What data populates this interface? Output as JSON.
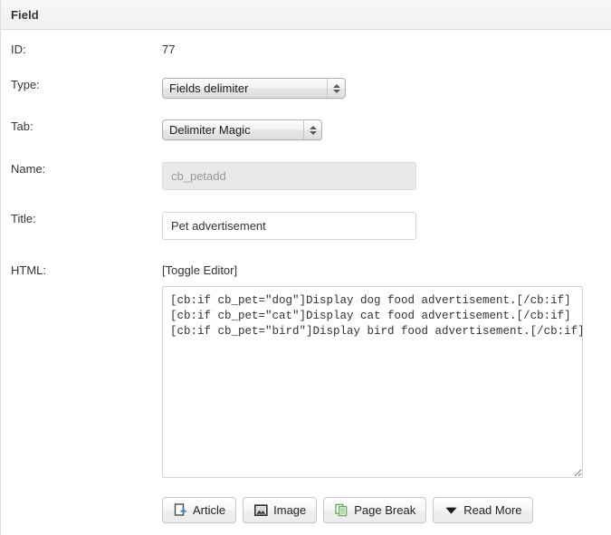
{
  "panel": {
    "header_title": "Field"
  },
  "form": {
    "labels": {
      "id": "ID:",
      "type": "Type:",
      "tab": "Tab:",
      "name": "Name:",
      "title": "Title:",
      "html": "HTML:"
    },
    "id_value": "77",
    "type_select": {
      "selected": "Fields delimiter",
      "options": [
        "Fields delimiter"
      ]
    },
    "tab_select": {
      "selected": "Delimiter Magic",
      "options": [
        "Delimiter Magic"
      ]
    },
    "name_input": {
      "value": "cb_petadd",
      "placeholder": "cb_petadd",
      "disabled": "true"
    },
    "title_input": {
      "value": "Pet advertisement",
      "placeholder": ""
    },
    "html_editor": {
      "toggle_label": "[Toggle Editor]",
      "content": "[cb:if cb_pet=\"dog\"]Display dog food advertisement.[/cb:if]\n[cb:if cb_pet=\"cat\"]Display cat food advertisement.[/cb:if]\n[cb:if cb_pet=\"bird\"]Display bird food advertisement.[/cb:if]"
    }
  },
  "toolbar": {
    "buttons": [
      {
        "label": "Article",
        "icon": "article-page-plus-icon"
      },
      {
        "label": "Image",
        "icon": "image-picture-icon"
      },
      {
        "label": "Page Break",
        "icon": "page-break-copy-icon"
      },
      {
        "label": "Read More",
        "icon": "chevron-down-icon"
      }
    ]
  },
  "colors": {
    "header_bg": "#f3f3f3",
    "border": "#dddddd",
    "text": "#333333",
    "disabled_bg": "#e9e9e9",
    "disabled_text": "#9a9a9a",
    "green_icon": "#6aab5e"
  }
}
